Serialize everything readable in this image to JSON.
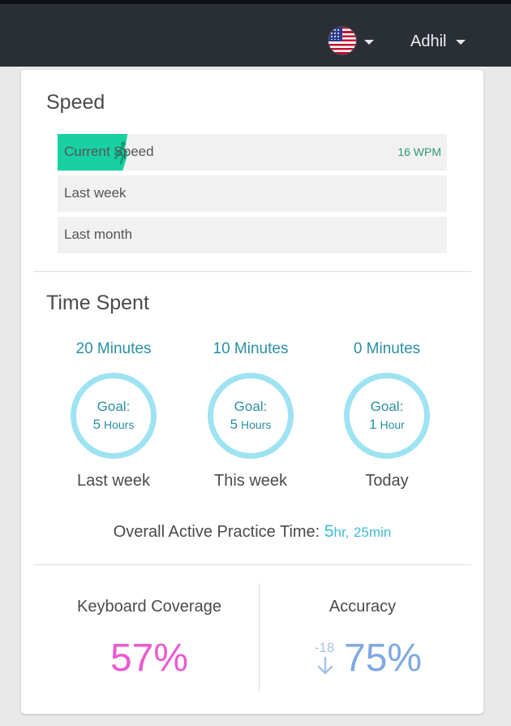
{
  "header": {
    "language_icon": "us-flag-icon",
    "user_name": "Adhil"
  },
  "speed": {
    "title": "Speed",
    "bars": {
      "current": {
        "label": "Current Speed",
        "value": "16 WPM",
        "fill_fraction": 0.18
      },
      "last_week": {
        "label": "Last week"
      },
      "last_month": {
        "label": "Last month"
      }
    },
    "fill_color": "#18d0a2"
  },
  "time_spent": {
    "title": "Time Spent",
    "columns": [
      {
        "minutes": "20 Minutes",
        "goal_label": "Goal:",
        "goal_num": "5",
        "goal_unit": "Hours",
        "period": "Last week"
      },
      {
        "minutes": "10 Minutes",
        "goal_label": "Goal:",
        "goal_num": "5",
        "goal_unit": "Hours",
        "period": "This week"
      },
      {
        "minutes": "0 Minutes",
        "goal_label": "Goal:",
        "goal_num": "1",
        "goal_unit": "Hour",
        "period": "Today"
      }
    ],
    "overall": {
      "label": "Overall Active Practice Time:",
      "hours_num": "5",
      "hours_unit": "hr,",
      "minutes": "25min"
    }
  },
  "stats": {
    "keyboard_coverage": {
      "label": "Keyboard Coverage",
      "value": "57%"
    },
    "accuracy": {
      "label": "Accuracy",
      "delta": "-18",
      "value": "75%"
    }
  },
  "colors": {
    "accent_teal": "#2a8fa3",
    "ring": "#9ee3f2",
    "coverage": "#ea5bd1",
    "accuracy": "#7fa9e0"
  }
}
